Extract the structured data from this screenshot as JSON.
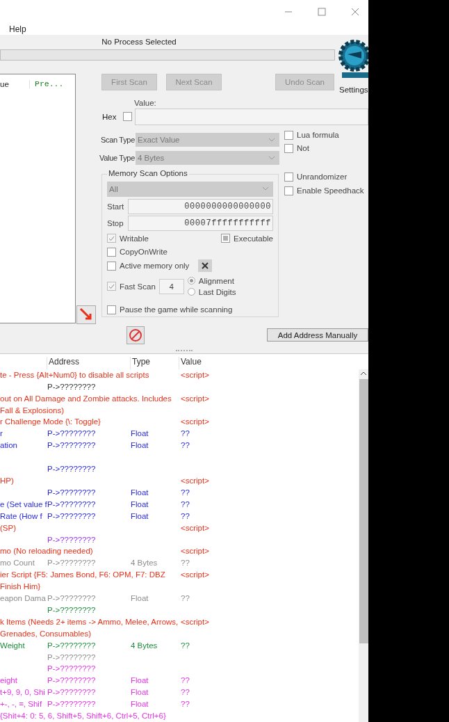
{
  "window": {
    "menu": [
      "Help"
    ],
    "status": "No Process Selected",
    "progress": {
      "level": 0
    }
  },
  "logo": {
    "label": "Settings"
  },
  "found_list": {
    "columns": [
      "ue",
      "Pre..."
    ]
  },
  "scan_buttons": [
    {
      "label": "First Scan",
      "disabled": true
    },
    {
      "label": "Next Scan",
      "disabled": true
    },
    {
      "label": "Undo Scan",
      "disabled": true
    }
  ],
  "value": {
    "label": "Value:",
    "hex_label": "Hex",
    "hex_checked": false
  },
  "scan_type": {
    "label": "Scan Type",
    "value": "Exact Value"
  },
  "value_type": {
    "label": "Value Type",
    "value": "4 Bytes"
  },
  "options": [
    {
      "label": "Lua formula",
      "checked": false
    },
    {
      "label": "Not",
      "checked": false
    },
    {
      "label": "Unrandomizer",
      "checked": false
    },
    {
      "label": "Enable Speedhack",
      "checked": false
    }
  ],
  "memory_scan": {
    "title": "Memory Scan Options",
    "region": "All",
    "start_label": "Start",
    "start": "0000000000000000",
    "stop_label": "Stop",
    "stop": "00007fffffffffff",
    "writable": {
      "label": "Writable",
      "checked": true
    },
    "executable": {
      "label": "Executable",
      "indeterminate": true
    },
    "copy_on_write": {
      "label": "CopyOnWrite",
      "checked": false
    },
    "active_memory_only": {
      "label": "Active memory only",
      "checked": false
    },
    "fast_scan": {
      "label": "Fast Scan",
      "checked": true,
      "value": "4"
    },
    "alignment_modes": [
      {
        "label": "Alignment",
        "selected": true
      },
      {
        "label": "Last Digits",
        "selected": false
      }
    ],
    "pause": {
      "label": "Pause the game while scanning",
      "checked": false
    }
  },
  "add_address_button": "Add Address Manually",
  "table": {
    "columns": [
      "Address",
      "Type",
      "Value"
    ],
    "rows": [
      {
        "kind": "entry",
        "description": "te - Press {Alt+Num0} to disable all scripts",
        "value": "<script>",
        "color": "#e8311a"
      },
      {
        "kind": "entry",
        "address": "P->????????",
        "color": "#333333"
      },
      {
        "kind": "entry",
        "description": "out on All Damage and Zombie attacks. Includes Fall & Explosions)",
        "value": "<script>",
        "color": "#e8311a"
      },
      {
        "kind": "entry",
        "description": "r Challenge Mode {\\: Toggle}",
        "value": "<script>",
        "color": "#e8311a"
      },
      {
        "kind": "entry",
        "description": "r",
        "address": "P->????????",
        "type": "Float",
        "value": "??",
        "color": "#2828e0"
      },
      {
        "kind": "entry",
        "description": "ation",
        "address": "P->????????",
        "type": "Float",
        "value": "??",
        "color": "#2828e0"
      },
      {
        "kind": "blank"
      },
      {
        "kind": "entry",
        "address": "P->????????",
        "color": "#2828e0"
      },
      {
        "kind": "entry",
        "description": "HP)",
        "value": "<script>",
        "color": "#e8311a"
      },
      {
        "kind": "entry",
        "address": "P->????????",
        "type": "Float",
        "value": "??",
        "color": "#2828e0"
      },
      {
        "kind": "entry",
        "description": "e (Set value f",
        "address": "P->????????",
        "type": "Float",
        "value": "??",
        "color": "#2828e0"
      },
      {
        "kind": "entry",
        "description": " Rate (How f",
        "address": "P->????????",
        "type": "Float",
        "value": "??",
        "color": "#2828e0"
      },
      {
        "kind": "entry",
        "description": "(SP)",
        "value": "<script>",
        "color": "#e8311a"
      },
      {
        "kind": "entry",
        "address": "P->????????",
        "color": "#9933ee"
      },
      {
        "kind": "entry",
        "description": "mo (No reloading needed)",
        "value": "<script>",
        "color": "#e8311a"
      },
      {
        "kind": "entry",
        "description": "mo Count",
        "address": "P->????????",
        "type": "4 Bytes",
        "value": "??",
        "color": "#8c8c8c"
      },
      {
        "kind": "entry",
        "description": "ier Script {F5: James Bond, F6: OPM, F7: DBZ Finish Him}",
        "value": "<script>",
        "color": "#e8311a"
      },
      {
        "kind": "entry",
        "description": "eapon Dama",
        "address": "P->????????",
        "type": "Float",
        "value": "??",
        "color": "#8c8c8c"
      },
      {
        "kind": "entry",
        "address": "P->????????",
        "color": "#1e8c3c"
      },
      {
        "kind": "entry",
        "description": "k Items (Needs 2+ items -> Ammo, Melee, Arrows, Grenades, Consumables)",
        "value": "<script>",
        "color": "#e8311a"
      },
      {
        "kind": "entry",
        "description": "Weight",
        "address": "P->????????",
        "type": "4 Bytes",
        "value": "??",
        "color": "#1e8c3c"
      },
      {
        "kind": "entry",
        "address": "P->????????",
        "color": "#8c8c8c"
      },
      {
        "kind": "entry",
        "address": "P->????????",
        "color": "#e632e6"
      },
      {
        "kind": "entry",
        "description": "eight",
        "address": "P->????????",
        "type": "Float",
        "value": "??",
        "color": "#e632e6"
      },
      {
        "kind": "entry",
        "description": "t+9, 9, 0, Shi",
        "address": "P->????????",
        "type": "Float",
        "value": "??",
        "color": "#e632e6"
      },
      {
        "kind": "entry",
        "description": "+-, -, =, Shif",
        "address": "P->????????",
        "type": "Float",
        "value": "??",
        "color": "#e632e6"
      },
      {
        "kind": "entry",
        "description": "{Shit+4: 0: 5, 6, Shift+5, Shift+6, Ctrl+5, Ctrl+6}",
        "color": "#e632e6"
      }
    ]
  }
}
